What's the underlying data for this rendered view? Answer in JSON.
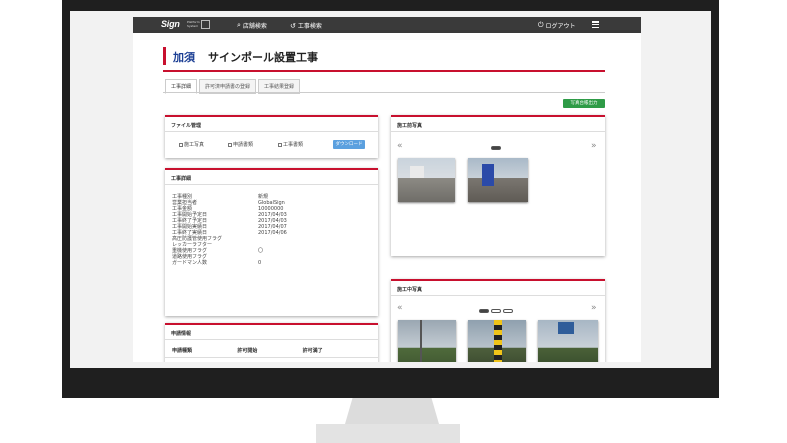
{
  "app": {
    "logo": "Sign",
    "logo_sub": "Platform System",
    "nav": {
      "store_search": "店舗検索",
      "work_search": "工事検索",
      "logout": "ログアウト"
    }
  },
  "page": {
    "title_city": "加須",
    "title_main": "サインポール設置工事"
  },
  "tabs": [
    {
      "label": "工事詳細"
    },
    {
      "label": "許可済申請書の登録"
    },
    {
      "label": "工事結果登録"
    }
  ],
  "print_button": "写真台帳出力",
  "file_panel": {
    "title": "ファイル管理",
    "checkboxes": [
      "施工写真",
      "申請書類",
      "工事書類"
    ],
    "download": "ダウンロード"
  },
  "detail_panel": {
    "title": "工事詳細",
    "rows": [
      {
        "label": "工事種別",
        "value": "新規"
      },
      {
        "label": "営業担当者",
        "value": "GlobalSign"
      },
      {
        "label": "工事金額",
        "value": "10000000"
      },
      {
        "label": "工事開始予定日",
        "value": "2017/04/03"
      },
      {
        "label": "工事終了予定日",
        "value": "2017/04/03"
      },
      {
        "label": "工事開始実績日",
        "value": "2017/04/07"
      },
      {
        "label": "工事終了実績日",
        "value": "2017/04/06"
      },
      {
        "label": "高圧防護管使用フラグ",
        "value": ""
      },
      {
        "label": "レッカーラフター",
        "value": ""
      },
      {
        "label": "重機使用フラグ",
        "value": "〇"
      },
      {
        "label": "道路使用フラグ",
        "value": ""
      },
      {
        "label": "ガードマン人数",
        "value": "0"
      }
    ]
  },
  "apply_panel": {
    "title": "申請情報",
    "columns": [
      "申請種類",
      "許可開始",
      "許可満了"
    ]
  },
  "before_panel": {
    "title": "施工前写真",
    "prev": "«",
    "next": "»"
  },
  "during_panel": {
    "title": "施工中写真",
    "prev": "«",
    "next": "»"
  }
}
